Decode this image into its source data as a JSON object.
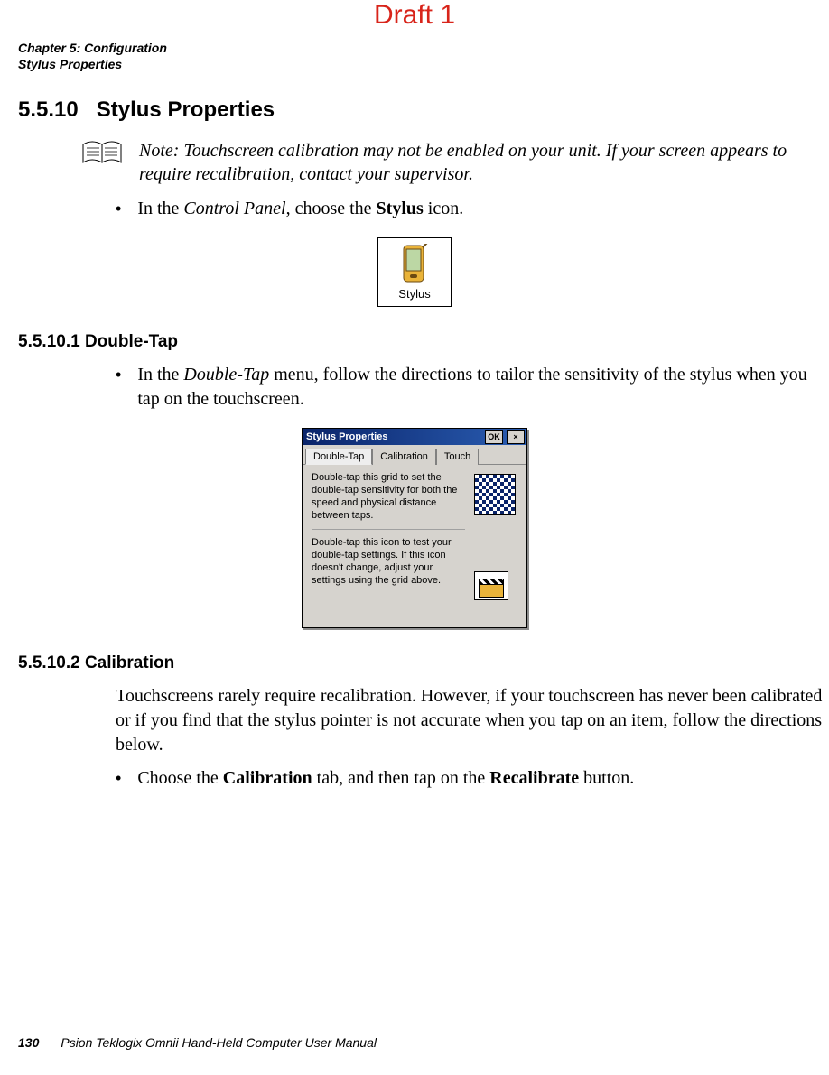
{
  "draft_label": "Draft 1",
  "running_head": {
    "line1": "Chapter 5: Configuration",
    "line2": "Stylus Properties"
  },
  "section": {
    "number": "5.5.10",
    "title": "Stylus Properties"
  },
  "note": {
    "lead": "Note:",
    "text": " Touchscreen calibration may not be enabled on your unit. If your screen appears to require recalibration, contact your supervisor."
  },
  "bullet1": {
    "pre": "In the ",
    "em": "Control Panel",
    "mid": ", choose the ",
    "strong": "Stylus",
    "post": " icon."
  },
  "stylus_icon_label": "Stylus",
  "sub1": {
    "number": "5.5.10.1",
    "title": "Double-Tap"
  },
  "bullet2": {
    "pre": "In the ",
    "em": "Double-Tap",
    "post": " menu, follow the directions to tailor the sensitivity of the stylus when you tap on the touchscreen."
  },
  "dialog": {
    "title": "Stylus Properties",
    "ok": "OK",
    "close": "×",
    "tabs": {
      "double_tap": "Double-Tap",
      "calibration": "Calibration",
      "touch": "Touch"
    },
    "para1": "Double-tap this grid to set the double-tap sensitivity for both the speed and physical distance between taps.",
    "para2": "Double-tap this icon to test your double-tap settings. If this icon doesn't change, adjust your settings using the grid above."
  },
  "sub2": {
    "number": "5.5.10.2",
    "title": "Calibration"
  },
  "calib_para": "Touchscreens rarely require recalibration. However, if your touchscreen has never been calibrated or if you find that the stylus pointer is not accurate when you tap on an item, follow the directions below.",
  "bullet3": {
    "pre": "Choose the ",
    "strong1": "Calibration",
    "mid": " tab, and then tap on the ",
    "strong2": "Recalibrate",
    "post": " button."
  },
  "footer": {
    "page": "130",
    "text": "Psion Teklogix Omnii Hand-Held Computer User Manual"
  }
}
